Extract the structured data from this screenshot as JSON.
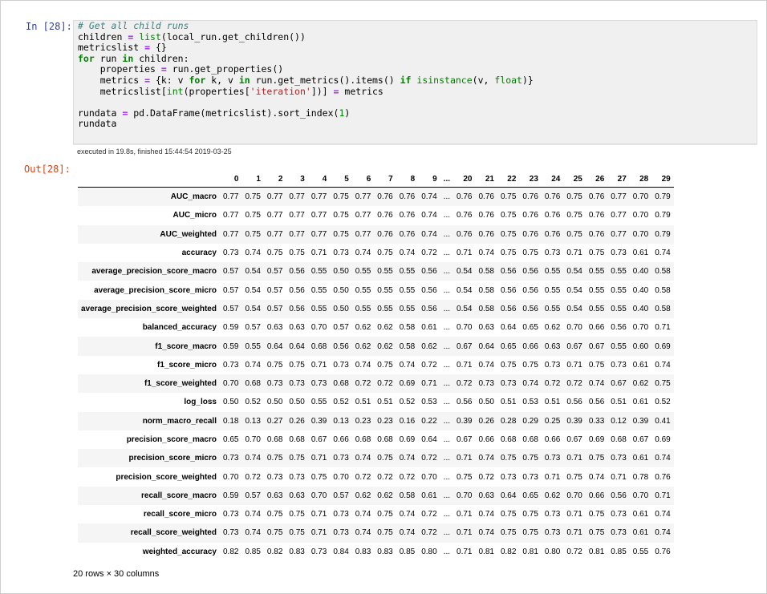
{
  "input_prompt": "In [28]:",
  "output_prompt": "Out[28]:",
  "code": {
    "comment": "# Get all child runs",
    "line2_a": "children ",
    "line2_eq": "=",
    "line2_fn": "list",
    "line2_b": "(local_run.get_children())",
    "line3_a": "metricslist ",
    "line3_eq": "=",
    "line3_b": " {}",
    "kw_for": "for",
    "line4_mid": " run ",
    "kw_in": "in",
    "line4_end": " children:",
    "line5_a": "    properties ",
    "line5_eq": "=",
    "line5_b": " run.get_properties()",
    "line6_a": "    metrics ",
    "line6_eq": "=",
    "line6_b": " {k: v ",
    "kw_for2": "for",
    "line6_c": " k, v ",
    "kw_in2": "in",
    "line6_d": " run.get_metrics().items() ",
    "kw_if": "if",
    "line6_fn": " isinstance",
    "line6_e": "(v, ",
    "line6_fl": "float",
    "line6_f": ")}",
    "line7_a": "    metricslist[",
    "line7_fn": "int",
    "line7_b": "(properties[",
    "line7_str": "'iteration'",
    "line7_c": "])] ",
    "line7_eq": "=",
    "line7_d": " metrics",
    "line9_a": "rundata ",
    "line9_eq": "=",
    "line9_b": " pd.DataFrame(metricslist).sort_index(",
    "line9_num": "1",
    "line9_c": ")",
    "line10": "rundata"
  },
  "execution_info": "executed in 19.8s, finished 15:44:54 2019-03-25",
  "table": {
    "columns": [
      "0",
      "1",
      "2",
      "3",
      "4",
      "5",
      "6",
      "7",
      "8",
      "9",
      "...",
      "20",
      "21",
      "22",
      "23",
      "24",
      "25",
      "26",
      "27",
      "28",
      "29"
    ],
    "rows": [
      {
        "label": "AUC_macro",
        "values": [
          "0.77",
          "0.75",
          "0.77",
          "0.77",
          "0.77",
          "0.75",
          "0.77",
          "0.76",
          "0.76",
          "0.74",
          "...",
          "0.76",
          "0.76",
          "0.75",
          "0.76",
          "0.76",
          "0.75",
          "0.76",
          "0.77",
          "0.70",
          "0.79"
        ]
      },
      {
        "label": "AUC_micro",
        "values": [
          "0.77",
          "0.75",
          "0.77",
          "0.77",
          "0.77",
          "0.75",
          "0.77",
          "0.76",
          "0.76",
          "0.74",
          "...",
          "0.76",
          "0.76",
          "0.75",
          "0.76",
          "0.76",
          "0.75",
          "0.76",
          "0.77",
          "0.70",
          "0.79"
        ]
      },
      {
        "label": "AUC_weighted",
        "values": [
          "0.77",
          "0.75",
          "0.77",
          "0.77",
          "0.77",
          "0.75",
          "0.77",
          "0.76",
          "0.76",
          "0.74",
          "...",
          "0.76",
          "0.76",
          "0.75",
          "0.76",
          "0.76",
          "0.75",
          "0.76",
          "0.77",
          "0.70",
          "0.79"
        ]
      },
      {
        "label": "accuracy",
        "values": [
          "0.73",
          "0.74",
          "0.75",
          "0.75",
          "0.71",
          "0.73",
          "0.74",
          "0.75",
          "0.74",
          "0.72",
          "...",
          "0.71",
          "0.74",
          "0.75",
          "0.75",
          "0.73",
          "0.71",
          "0.75",
          "0.73",
          "0.61",
          "0.74"
        ]
      },
      {
        "label": "average_precision_score_macro",
        "values": [
          "0.57",
          "0.54",
          "0.57",
          "0.56",
          "0.55",
          "0.50",
          "0.55",
          "0.55",
          "0.55",
          "0.56",
          "...",
          "0.54",
          "0.58",
          "0.56",
          "0.56",
          "0.55",
          "0.54",
          "0.55",
          "0.55",
          "0.40",
          "0.58"
        ]
      },
      {
        "label": "average_precision_score_micro",
        "values": [
          "0.57",
          "0.54",
          "0.57",
          "0.56",
          "0.55",
          "0.50",
          "0.55",
          "0.55",
          "0.55",
          "0.56",
          "...",
          "0.54",
          "0.58",
          "0.56",
          "0.56",
          "0.55",
          "0.54",
          "0.55",
          "0.55",
          "0.40",
          "0.58"
        ]
      },
      {
        "label": "average_precision_score_weighted",
        "values": [
          "0.57",
          "0.54",
          "0.57",
          "0.56",
          "0.55",
          "0.50",
          "0.55",
          "0.55",
          "0.55",
          "0.56",
          "...",
          "0.54",
          "0.58",
          "0.56",
          "0.56",
          "0.55",
          "0.54",
          "0.55",
          "0.55",
          "0.40",
          "0.58"
        ]
      },
      {
        "label": "balanced_accuracy",
        "values": [
          "0.59",
          "0.57",
          "0.63",
          "0.63",
          "0.70",
          "0.57",
          "0.62",
          "0.62",
          "0.58",
          "0.61",
          "...",
          "0.70",
          "0.63",
          "0.64",
          "0.65",
          "0.62",
          "0.70",
          "0.66",
          "0.56",
          "0.70",
          "0.71"
        ]
      },
      {
        "label": "f1_score_macro",
        "values": [
          "0.59",
          "0.55",
          "0.64",
          "0.64",
          "0.68",
          "0.56",
          "0.62",
          "0.62",
          "0.58",
          "0.62",
          "...",
          "0.67",
          "0.64",
          "0.65",
          "0.66",
          "0.63",
          "0.67",
          "0.67",
          "0.55",
          "0.60",
          "0.69"
        ]
      },
      {
        "label": "f1_score_micro",
        "values": [
          "0.73",
          "0.74",
          "0.75",
          "0.75",
          "0.71",
          "0.73",
          "0.74",
          "0.75",
          "0.74",
          "0.72",
          "...",
          "0.71",
          "0.74",
          "0.75",
          "0.75",
          "0.73",
          "0.71",
          "0.75",
          "0.73",
          "0.61",
          "0.74"
        ]
      },
      {
        "label": "f1_score_weighted",
        "values": [
          "0.70",
          "0.68",
          "0.73",
          "0.73",
          "0.73",
          "0.68",
          "0.72",
          "0.72",
          "0.69",
          "0.71",
          "...",
          "0.72",
          "0.73",
          "0.73",
          "0.74",
          "0.72",
          "0.72",
          "0.74",
          "0.67",
          "0.62",
          "0.75"
        ]
      },
      {
        "label": "log_loss",
        "values": [
          "0.50",
          "0.52",
          "0.50",
          "0.50",
          "0.55",
          "0.52",
          "0.51",
          "0.51",
          "0.52",
          "0.53",
          "...",
          "0.56",
          "0.50",
          "0.51",
          "0.53",
          "0.51",
          "0.56",
          "0.56",
          "0.51",
          "0.61",
          "0.52"
        ]
      },
      {
        "label": "norm_macro_recall",
        "values": [
          "0.18",
          "0.13",
          "0.27",
          "0.26",
          "0.39",
          "0.13",
          "0.23",
          "0.23",
          "0.16",
          "0.22",
          "...",
          "0.39",
          "0.26",
          "0.28",
          "0.29",
          "0.25",
          "0.39",
          "0.33",
          "0.12",
          "0.39",
          "0.41"
        ]
      },
      {
        "label": "precision_score_macro",
        "values": [
          "0.65",
          "0.70",
          "0.68",
          "0.68",
          "0.67",
          "0.66",
          "0.68",
          "0.68",
          "0.69",
          "0.64",
          "...",
          "0.67",
          "0.66",
          "0.68",
          "0.68",
          "0.66",
          "0.67",
          "0.69",
          "0.68",
          "0.67",
          "0.69"
        ]
      },
      {
        "label": "precision_score_micro",
        "values": [
          "0.73",
          "0.74",
          "0.75",
          "0.75",
          "0.71",
          "0.73",
          "0.74",
          "0.75",
          "0.74",
          "0.72",
          "...",
          "0.71",
          "0.74",
          "0.75",
          "0.75",
          "0.73",
          "0.71",
          "0.75",
          "0.73",
          "0.61",
          "0.74"
        ]
      },
      {
        "label": "precision_score_weighted",
        "values": [
          "0.70",
          "0.72",
          "0.73",
          "0.73",
          "0.75",
          "0.70",
          "0.72",
          "0.72",
          "0.72",
          "0.70",
          "...",
          "0.75",
          "0.72",
          "0.73",
          "0.73",
          "0.71",
          "0.75",
          "0.74",
          "0.71",
          "0.78",
          "0.76"
        ]
      },
      {
        "label": "recall_score_macro",
        "values": [
          "0.59",
          "0.57",
          "0.63",
          "0.63",
          "0.70",
          "0.57",
          "0.62",
          "0.62",
          "0.58",
          "0.61",
          "...",
          "0.70",
          "0.63",
          "0.64",
          "0.65",
          "0.62",
          "0.70",
          "0.66",
          "0.56",
          "0.70",
          "0.71"
        ]
      },
      {
        "label": "recall_score_micro",
        "values": [
          "0.73",
          "0.74",
          "0.75",
          "0.75",
          "0.71",
          "0.73",
          "0.74",
          "0.75",
          "0.74",
          "0.72",
          "...",
          "0.71",
          "0.74",
          "0.75",
          "0.75",
          "0.73",
          "0.71",
          "0.75",
          "0.73",
          "0.61",
          "0.74"
        ]
      },
      {
        "label": "recall_score_weighted",
        "values": [
          "0.73",
          "0.74",
          "0.75",
          "0.75",
          "0.71",
          "0.73",
          "0.74",
          "0.75",
          "0.74",
          "0.72",
          "...",
          "0.71",
          "0.74",
          "0.75",
          "0.75",
          "0.73",
          "0.71",
          "0.75",
          "0.73",
          "0.61",
          "0.74"
        ]
      },
      {
        "label": "weighted_accuracy",
        "values": [
          "0.82",
          "0.85",
          "0.82",
          "0.83",
          "0.73",
          "0.84",
          "0.83",
          "0.83",
          "0.85",
          "0.80",
          "...",
          "0.71",
          "0.81",
          "0.82",
          "0.81",
          "0.80",
          "0.72",
          "0.81",
          "0.85",
          "0.55",
          "0.76"
        ]
      }
    ]
  },
  "summary": "20 rows × 30 columns"
}
